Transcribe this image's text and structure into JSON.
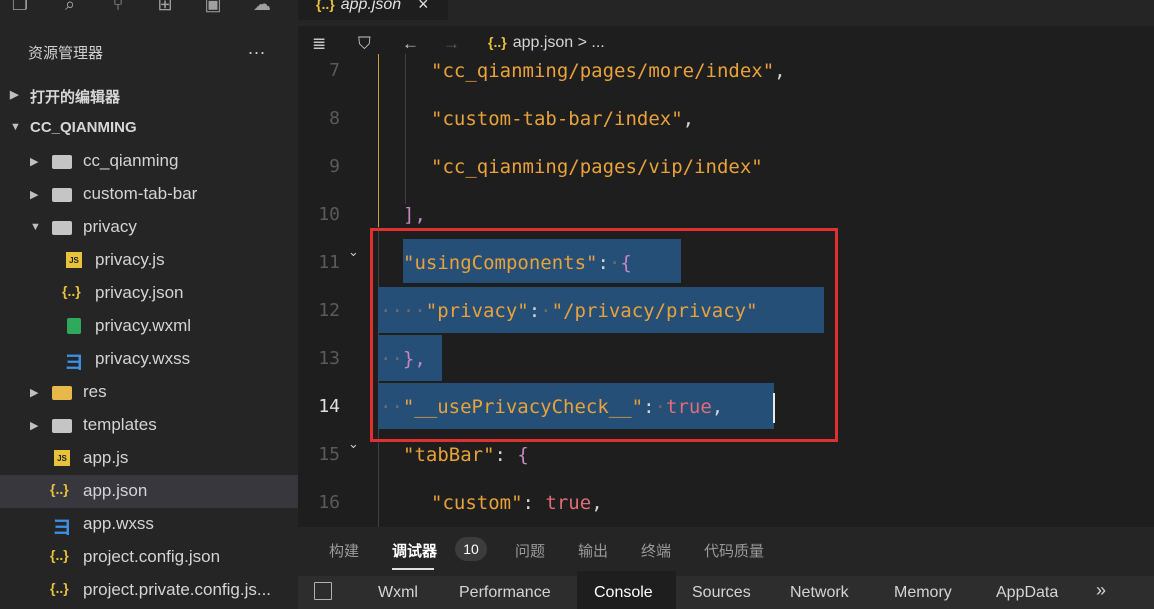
{
  "activity_icons": [
    "explorer-icon",
    "search-icon",
    "source-control-icon",
    "extensions-icon",
    "save-icon",
    "debug-icon"
  ],
  "explorer": {
    "title": "资源管理器",
    "more": "...",
    "sections": {
      "open_editors": "打开的编辑器",
      "project": "CC_QIANMING"
    },
    "tree": [
      {
        "label": "cc_qianming",
        "type": "folder",
        "expanded": false
      },
      {
        "label": "custom-tab-bar",
        "type": "folder",
        "expanded": false
      },
      {
        "label": "privacy",
        "type": "folder",
        "expanded": true
      },
      {
        "label": "privacy.js",
        "type": "js"
      },
      {
        "label": "privacy.json",
        "type": "json"
      },
      {
        "label": "privacy.wxml",
        "type": "wxml"
      },
      {
        "label": "privacy.wxss",
        "type": "wxss"
      },
      {
        "label": "res",
        "type": "folder",
        "expanded": false
      },
      {
        "label": "templates",
        "type": "folder",
        "expanded": false
      },
      {
        "label": "app.js",
        "type": "js"
      },
      {
        "label": "app.json",
        "type": "json",
        "selected": true
      },
      {
        "label": "app.wxss",
        "type": "wxss"
      },
      {
        "label": "project.config.json",
        "type": "json"
      },
      {
        "label": "project.private.config.js...",
        "type": "json"
      }
    ]
  },
  "tab": {
    "icon": "{..}",
    "label": "app.json",
    "close": "×"
  },
  "breadcrumb": {
    "icon": "{..}",
    "label": "app.json > ..."
  },
  "editor": {
    "line_numbers": [
      "7",
      "8",
      "9",
      "10",
      "11",
      "12",
      "13",
      "14",
      "15",
      "16"
    ],
    "current_line": "14",
    "lines": {
      "l7": "\"cc_qianming/pages/more/index\"",
      "l7c": ",",
      "l8": "\"custom-tab-bar/index\"",
      "l8c": ",",
      "l9": "\"cc_qianming/pages/vip/index\"",
      "l10": "],",
      "l11k": "\"usingComponents\"",
      "l11c": ":",
      "l11b": "{",
      "l12k": "\"privacy\"",
      "l12c": ":",
      "l12v": "\"/privacy/privacy\"",
      "l13": "},",
      "l14k": "\"__usePrivacyCheck__\"",
      "l14c": ":",
      "l14v": "true",
      "l14e": ",",
      "l15k": "\"tabBar\"",
      "l15c": ":",
      "l15b": "{",
      "l16k": "\"custom\"",
      "l16c": ":",
      "l16v": "true",
      "l16e": ","
    }
  },
  "panel": {
    "tabs": [
      "构建",
      "调试器",
      "问题",
      "输出",
      "终端",
      "代码质量"
    ],
    "active_tab": "调试器",
    "badge": "10",
    "devtools_tabs": [
      "Wxml",
      "Performance",
      "Console",
      "Sources",
      "Network",
      "Memory",
      "AppData"
    ],
    "devtools_active": "Console",
    "more": "»"
  },
  "colors": {
    "highlight_box": "#e03030",
    "selection": "#264f78",
    "string": "#e8a23a",
    "boolean": "#e06c75"
  }
}
